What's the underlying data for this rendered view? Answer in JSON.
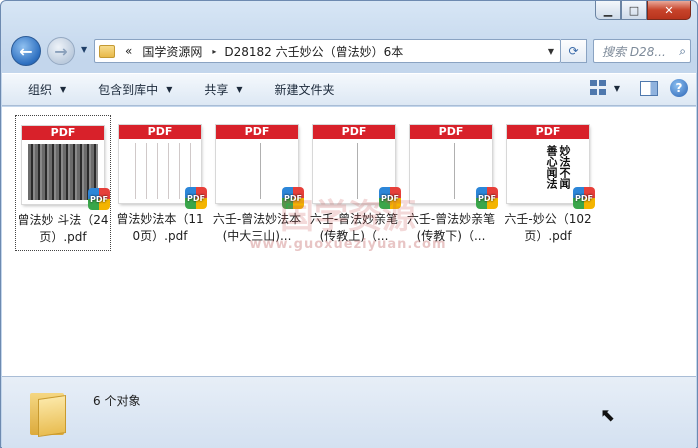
{
  "window": {
    "minimize": "▁",
    "maximize": "□",
    "close": "✕"
  },
  "address": {
    "overflow": "«",
    "crumbs": [
      "国学资源网",
      "D28182 六壬妙公（曾法妙）6本"
    ],
    "separator": "▸",
    "search_placeholder": "搜索 D28...",
    "search_icon": "search-icon"
  },
  "toolbar": {
    "organize": "组织",
    "include_library": "包含到库中",
    "share": "共享",
    "new_folder": "新建文件夹"
  },
  "files": [
    {
      "name": "曾法妙 斗法（24页）.pdf",
      "badge": "PDF"
    },
    {
      "name": "曾法妙法本（110页）.pdf",
      "badge": "PDF"
    },
    {
      "name": "六壬-曾法妙法本(中大三山)...",
      "badge": "PDF"
    },
    {
      "name": "六壬-曾法妙亲笔(传教上)（...",
      "badge": "PDF"
    },
    {
      "name": "六壬-曾法妙亲笔(传教下)（...",
      "badge": "PDF"
    },
    {
      "name": "六壬-妙公（102页）.pdf",
      "badge": "PDF"
    }
  ],
  "thumb_label": "PDF",
  "calligraphy": "妙法不闻 善心闻法",
  "watermark": {
    "text": "国学资源",
    "url": "www.guoxueziyuan.com"
  },
  "status": {
    "count_text": "6 个对象"
  },
  "colors": {
    "pdf_band": "#d8212a",
    "accent": "#2d6fc0"
  }
}
